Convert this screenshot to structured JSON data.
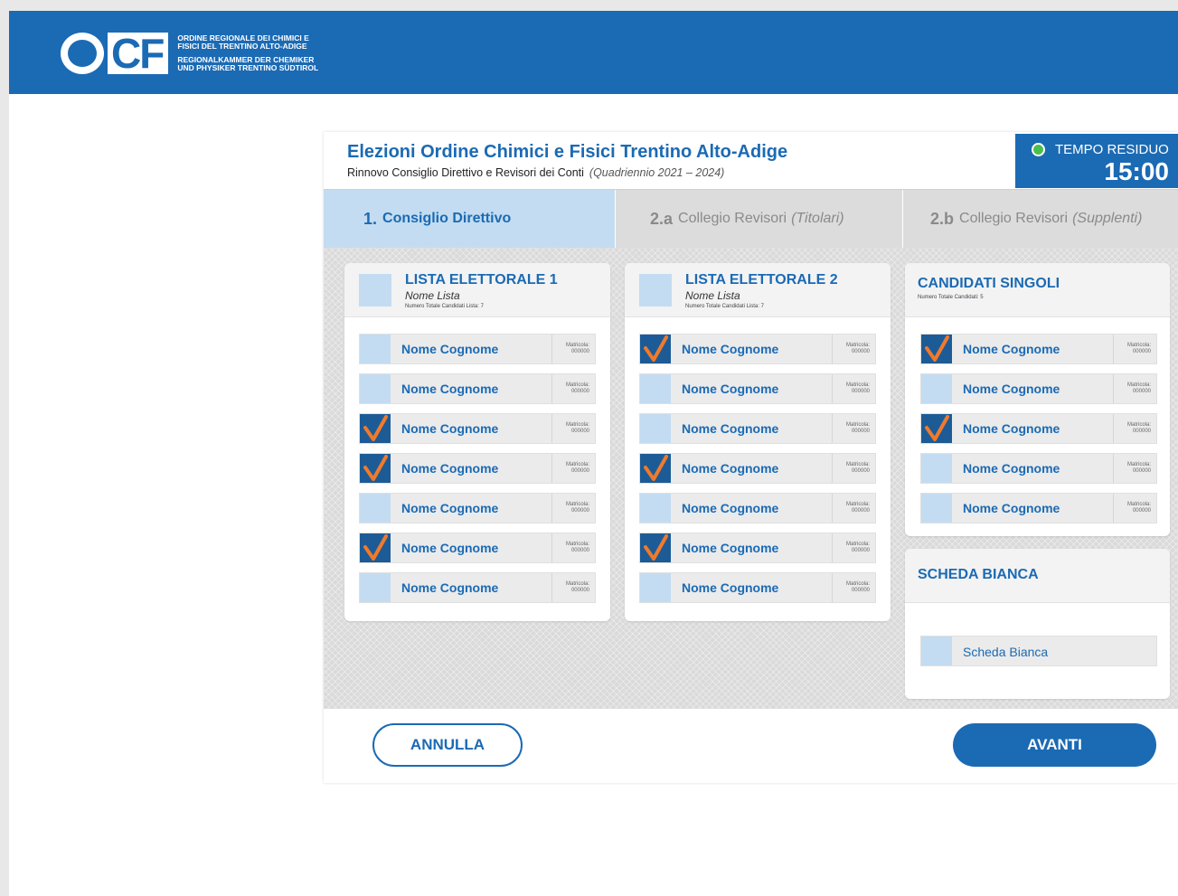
{
  "header": {
    "logo_text": "OCF",
    "org_lines": [
      "ORDINE REGIONALE DEI CHIMICI E",
      "FISICI DEL TRENTINO ALTO-ADIGE",
      "REGIONALKAMMER DER CHEMIKER",
      "UND PHYSIKER TRENTINO SÜDTIROL"
    ]
  },
  "panel": {
    "title": "Elezioni Ordine Chimici e Fisici Trentino Alto-Adige",
    "subtitle": "Rinnovo Consiglio Direttivo e Revisori dei Conti",
    "period": "(Quadriennio 2021 – 2024)"
  },
  "timer": {
    "label": "TEMPO RESIDUO",
    "value": "15:00"
  },
  "tabs": [
    {
      "num": "1.",
      "label": "Consiglio Direttivo",
      "extra": ""
    },
    {
      "num": "2.a",
      "label": "Collegio Revisori",
      "extra": "(Titolari)"
    },
    {
      "num": "2.b",
      "label": "Collegio Revisori",
      "extra": "(Supplenti)"
    }
  ],
  "lists": [
    {
      "title": "LISTA ELETTORALE 1",
      "nome": "Nome Lista",
      "meta": "Numero Totale Candidati Lista: 7",
      "candidates": [
        {
          "name": "Nome Cognome",
          "checked": false
        },
        {
          "name": "Nome Cognome",
          "checked": false
        },
        {
          "name": "Nome Cognome",
          "checked": true
        },
        {
          "name": "Nome Cognome",
          "checked": true
        },
        {
          "name": "Nome Cognome",
          "checked": false
        },
        {
          "name": "Nome Cognome",
          "checked": true
        },
        {
          "name": "Nome Cognome",
          "checked": false
        }
      ]
    },
    {
      "title": "LISTA ELETTORALE 2",
      "nome": "Nome Lista",
      "meta": "Numero Totale Candidati Lista: 7",
      "candidates": [
        {
          "name": "Nome Cognome",
          "checked": true
        },
        {
          "name": "Nome Cognome",
          "checked": false
        },
        {
          "name": "Nome Cognome",
          "checked": false
        },
        {
          "name": "Nome Cognome",
          "checked": true
        },
        {
          "name": "Nome Cognome",
          "checked": false
        },
        {
          "name": "Nome Cognome",
          "checked": true
        },
        {
          "name": "Nome Cognome",
          "checked": false
        }
      ]
    }
  ],
  "singoli": {
    "title": "CANDIDATI SINGOLI",
    "meta": "Numero Totale Candidati: 5",
    "candidates": [
      {
        "name": "Nome Cognome",
        "checked": true
      },
      {
        "name": "Nome Cognome",
        "checked": false
      },
      {
        "name": "Nome Cognome",
        "checked": true
      },
      {
        "name": "Nome Cognome",
        "checked": false
      },
      {
        "name": "Nome Cognome",
        "checked": false
      }
    ]
  },
  "matricola": {
    "label": "Matricola:",
    "value": "000000"
  },
  "bianca": {
    "title": "SCHEDA BIANCA",
    "option": "Scheda Bianca"
  },
  "footer": {
    "cancel": "ANNULLA",
    "next": "AVANTI"
  },
  "colors": {
    "brand": "#1b6ab4",
    "checkbox": "#c3dcf1",
    "checked": "#1d5b96",
    "checkmark": "#f07a2b",
    "timer_dot": "#4bbe4e"
  }
}
